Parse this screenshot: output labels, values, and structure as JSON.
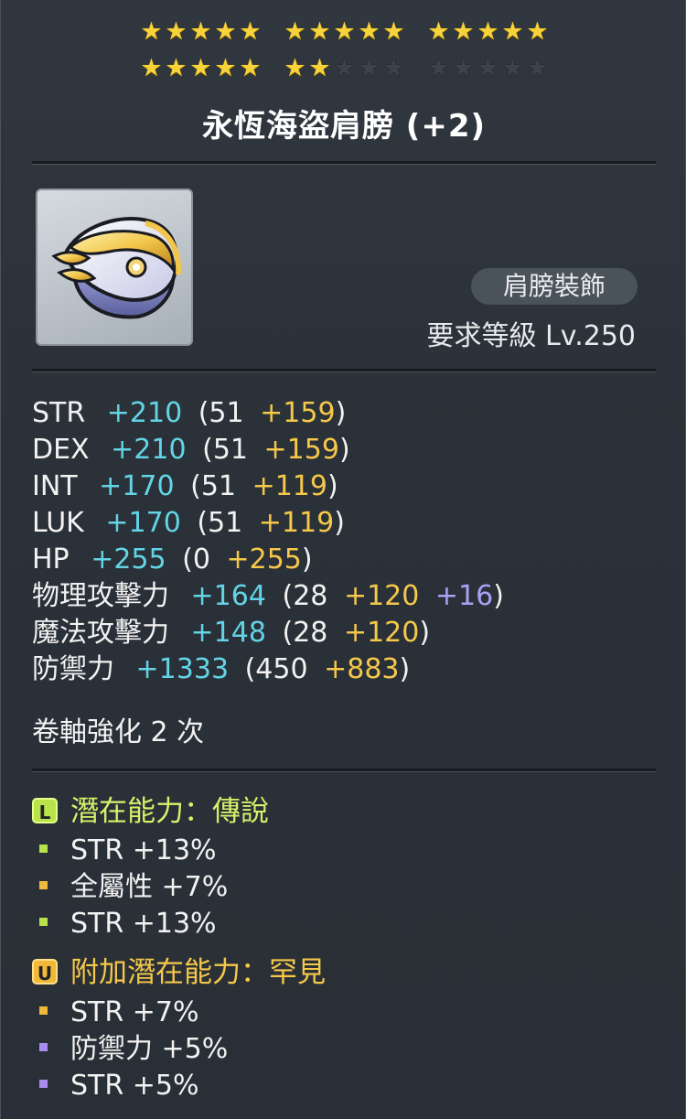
{
  "colors": {
    "stat_total": "#63d4e6",
    "stat_bonus": "#f5c84a",
    "stat_enhance": "#a9a2f4",
    "potential_legendary": "#d6f26a",
    "potential_unique": "#f5c84a",
    "star_on": "#f7d23a",
    "star_off": "#3d434a"
  },
  "star_force": {
    "filled": 22,
    "total": 30
  },
  "item": {
    "name": "永恆海盜肩膀 (+2)",
    "category": "肩膀裝飾",
    "required_level": "要求等級 Lv.250",
    "icon": "golden-pirate-shoulder-icon"
  },
  "stats": [
    {
      "name": "STR",
      "total": "+210",
      "open": "(51",
      "bonus": "+159",
      "enhance": "",
      "close": ")"
    },
    {
      "name": "DEX",
      "total": "+210",
      "open": "(51",
      "bonus": "+159",
      "enhance": "",
      "close": ")"
    },
    {
      "name": "INT",
      "total": "+170",
      "open": "(51",
      "bonus": "+119",
      "enhance": "",
      "close": ")"
    },
    {
      "name": "LUK",
      "total": "+170",
      "open": "(51",
      "bonus": "+119",
      "enhance": "",
      "close": ")"
    },
    {
      "name": "HP",
      "total": "+255",
      "open": "(0",
      "bonus": "+255",
      "enhance": "",
      "close": ")"
    },
    {
      "name": "物理攻擊力",
      "total": "+164",
      "open": "(28",
      "bonus": "+120",
      "enhance": "+16",
      "close": ")"
    },
    {
      "name": "魔法攻擊力",
      "total": "+148",
      "open": "(28",
      "bonus": "+120",
      "enhance": "",
      "close": ")"
    },
    {
      "name": "防禦力",
      "total": "+1333",
      "open": "(450",
      "bonus": "+883",
      "enhance": "",
      "close": ")"
    }
  ],
  "scroll_upgrades": "卷軸強化 2 次",
  "potential": {
    "tier_letter": "L",
    "title": "潛在能力：傳說",
    "lines": [
      "STR +13%",
      "全屬性 +7%",
      "STR +13%"
    ]
  },
  "additional_potential": {
    "tier_letter": "U",
    "title": "附加潛在能力：罕見",
    "lines": [
      "STR +7%",
      "防禦力 +5%",
      "STR +5%"
    ]
  }
}
